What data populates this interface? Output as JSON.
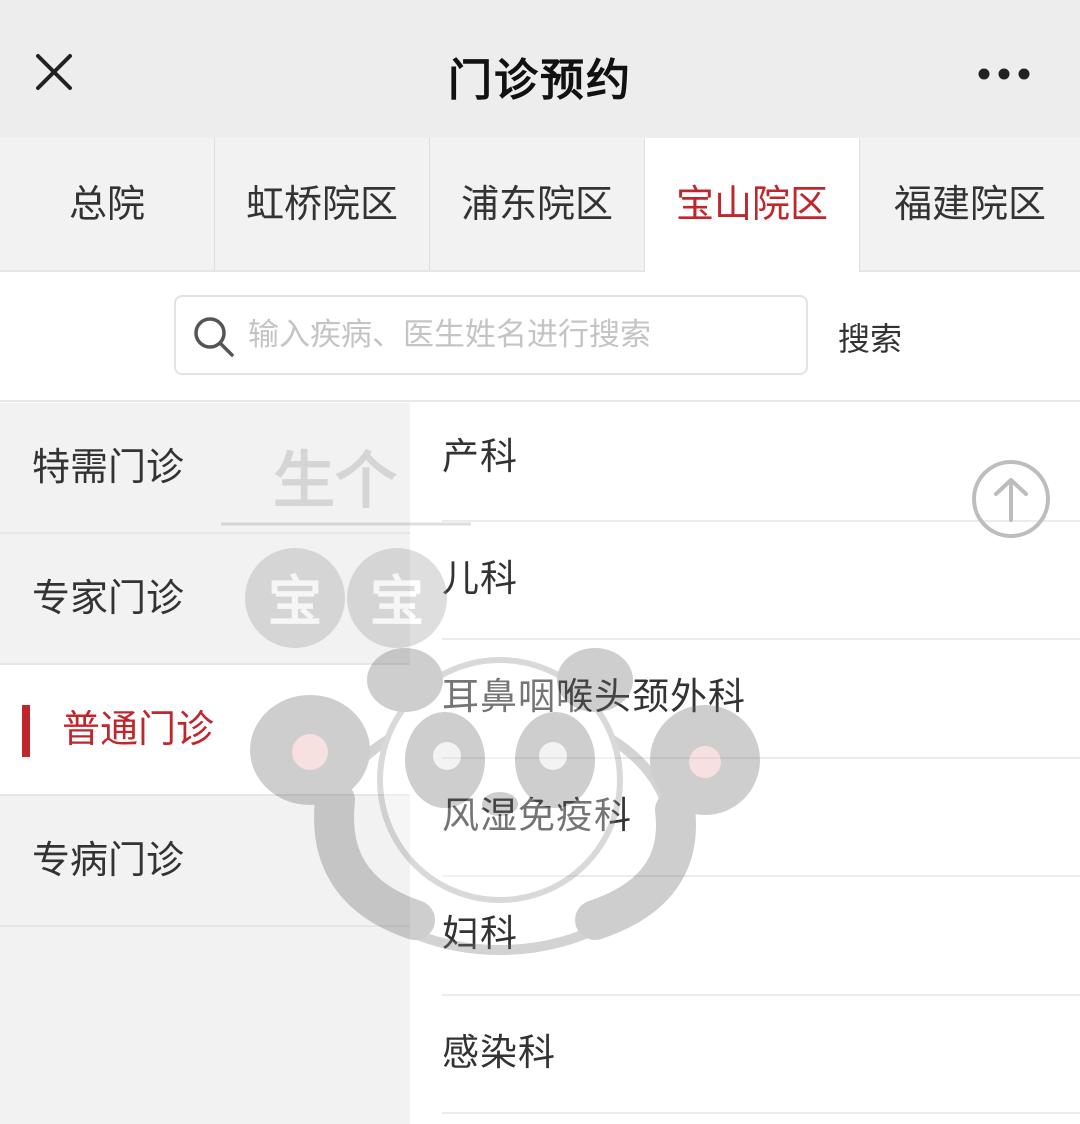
{
  "header": {
    "title": "门诊预约",
    "close_icon": "close-icon",
    "more_icon": "more-dots-icon"
  },
  "campus_tabs": [
    {
      "label": "总院",
      "active": false
    },
    {
      "label": "虹桥院区",
      "active": false
    },
    {
      "label": "浦东院区",
      "active": false
    },
    {
      "label": "宝山院区",
      "active": true
    },
    {
      "label": "福建院区",
      "active": false
    }
  ],
  "search": {
    "placeholder": "输入疾病、医生姓名进行搜索",
    "value": "",
    "button_label": "搜索",
    "icon": "search-icon"
  },
  "categories": [
    {
      "label": "特需门诊",
      "active": false
    },
    {
      "label": "专家门诊",
      "active": false
    },
    {
      "label": "普通门诊",
      "active": true
    },
    {
      "label": "专病门诊",
      "active": false
    }
  ],
  "departments": [
    {
      "label": "产科"
    },
    {
      "label": "儿科"
    },
    {
      "label": "耳鼻咽喉头颈外科"
    },
    {
      "label": "风湿免疫科"
    },
    {
      "label": "妇科"
    },
    {
      "label": "感染科"
    }
  ],
  "watermark": {
    "line1": "生个",
    "line2": "宝宝"
  },
  "colors": {
    "accent": "#c0272d",
    "header_bg": "#ededed",
    "panel_bg": "#f2f2f2"
  }
}
